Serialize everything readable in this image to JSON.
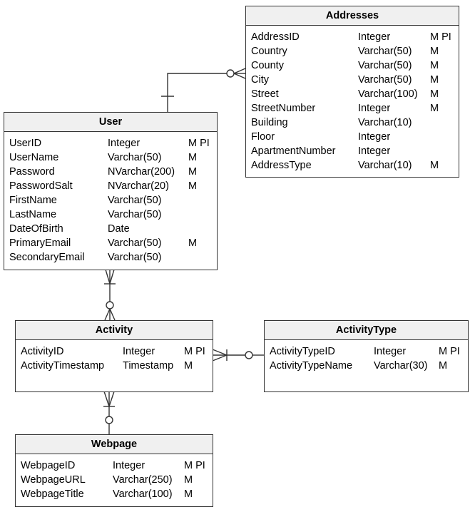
{
  "entities": {
    "addresses": {
      "title": "Addresses",
      "rows": [
        {
          "name": "AddressID",
          "type": "Integer",
          "flags": "M PI"
        },
        {
          "name": "Country",
          "type": "Varchar(50)",
          "flags": "M"
        },
        {
          "name": "County",
          "type": "Varchar(50)",
          "flags": "M"
        },
        {
          "name": "City",
          "type": "Varchar(50)",
          "flags": "M"
        },
        {
          "name": "Street",
          "type": "Varchar(100)",
          "flags": "M"
        },
        {
          "name": "StreetNumber",
          "type": "Integer",
          "flags": "M"
        },
        {
          "name": "Building",
          "type": "Varchar(10)",
          "flags": ""
        },
        {
          "name": "Floor",
          "type": "Integer",
          "flags": ""
        },
        {
          "name": "ApartmentNumber",
          "type": "Integer",
          "flags": ""
        },
        {
          "name": "AddressType",
          "type": "Varchar(10)",
          "flags": "M"
        }
      ]
    },
    "user": {
      "title": "User",
      "rows": [
        {
          "name": "UserID",
          "type": "Integer",
          "flags": "M PI"
        },
        {
          "name": "UserName",
          "type": "Varchar(50)",
          "flags": "M"
        },
        {
          "name": "Password",
          "type": "NVarchar(200)",
          "flags": "M"
        },
        {
          "name": "PasswordSalt",
          "type": "NVarchar(20)",
          "flags": "M"
        },
        {
          "name": "FirstName",
          "type": "Varchar(50)",
          "flags": ""
        },
        {
          "name": "LastName",
          "type": "Varchar(50)",
          "flags": ""
        },
        {
          "name": "DateOfBirth",
          "type": "Date",
          "flags": ""
        },
        {
          "name": "PrimaryEmail",
          "type": "Varchar(50)",
          "flags": "M"
        },
        {
          "name": "SecondaryEmail",
          "type": "Varchar(50)",
          "flags": ""
        }
      ]
    },
    "activity": {
      "title": "Activity",
      "rows": [
        {
          "name": "ActivityID",
          "type": "Integer",
          "flags": "M PI"
        },
        {
          "name": "ActivityTimestamp",
          "type": "Timestamp",
          "flags": "M"
        }
      ]
    },
    "activitytype": {
      "title": "ActivityType",
      "rows": [
        {
          "name": "ActivityTypeID",
          "type": "Integer",
          "flags": "M PI"
        },
        {
          "name": "ActivityTypeName",
          "type": "Varchar(30)",
          "flags": "M"
        }
      ]
    },
    "webpage": {
      "title": "Webpage",
      "rows": [
        {
          "name": "WebpageID",
          "type": "Integer",
          "flags": "M PI"
        },
        {
          "name": "WebpageURL",
          "type": "Varchar(250)",
          "flags": "M"
        },
        {
          "name": "WebpageTitle",
          "type": "Varchar(100)",
          "flags": "M"
        }
      ]
    }
  },
  "relationships": [
    {
      "from": "User",
      "to": "Addresses",
      "from_end": "one",
      "to_end": "zero-or-many"
    },
    {
      "from": "User",
      "to": "Activity",
      "from_end": "one-or-many",
      "to_end": "zero-or-many"
    },
    {
      "from": "Activity",
      "to": "Webpage",
      "from_end": "one-or-many",
      "to_end": "zero-or-one"
    },
    {
      "from": "Activity",
      "to": "ActivityType",
      "from_end": "one-or-many",
      "to_end": "zero-or-one"
    }
  ],
  "colors": {
    "line": "#333333",
    "header_bg": "#f0f0f0"
  }
}
